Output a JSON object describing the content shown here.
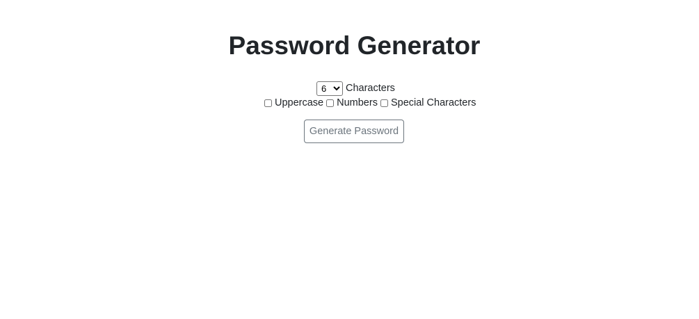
{
  "page": {
    "title": "Password Generator"
  },
  "length": {
    "selected": "6",
    "options": [
      "6"
    ],
    "label": "Characters"
  },
  "options": {
    "uppercase": {
      "label": "Uppercase",
      "checked": false
    },
    "numbers": {
      "label": "Numbers",
      "checked": false
    },
    "special": {
      "label": "Special Characters",
      "checked": false
    }
  },
  "actions": {
    "generate_label": "Generate Password"
  }
}
